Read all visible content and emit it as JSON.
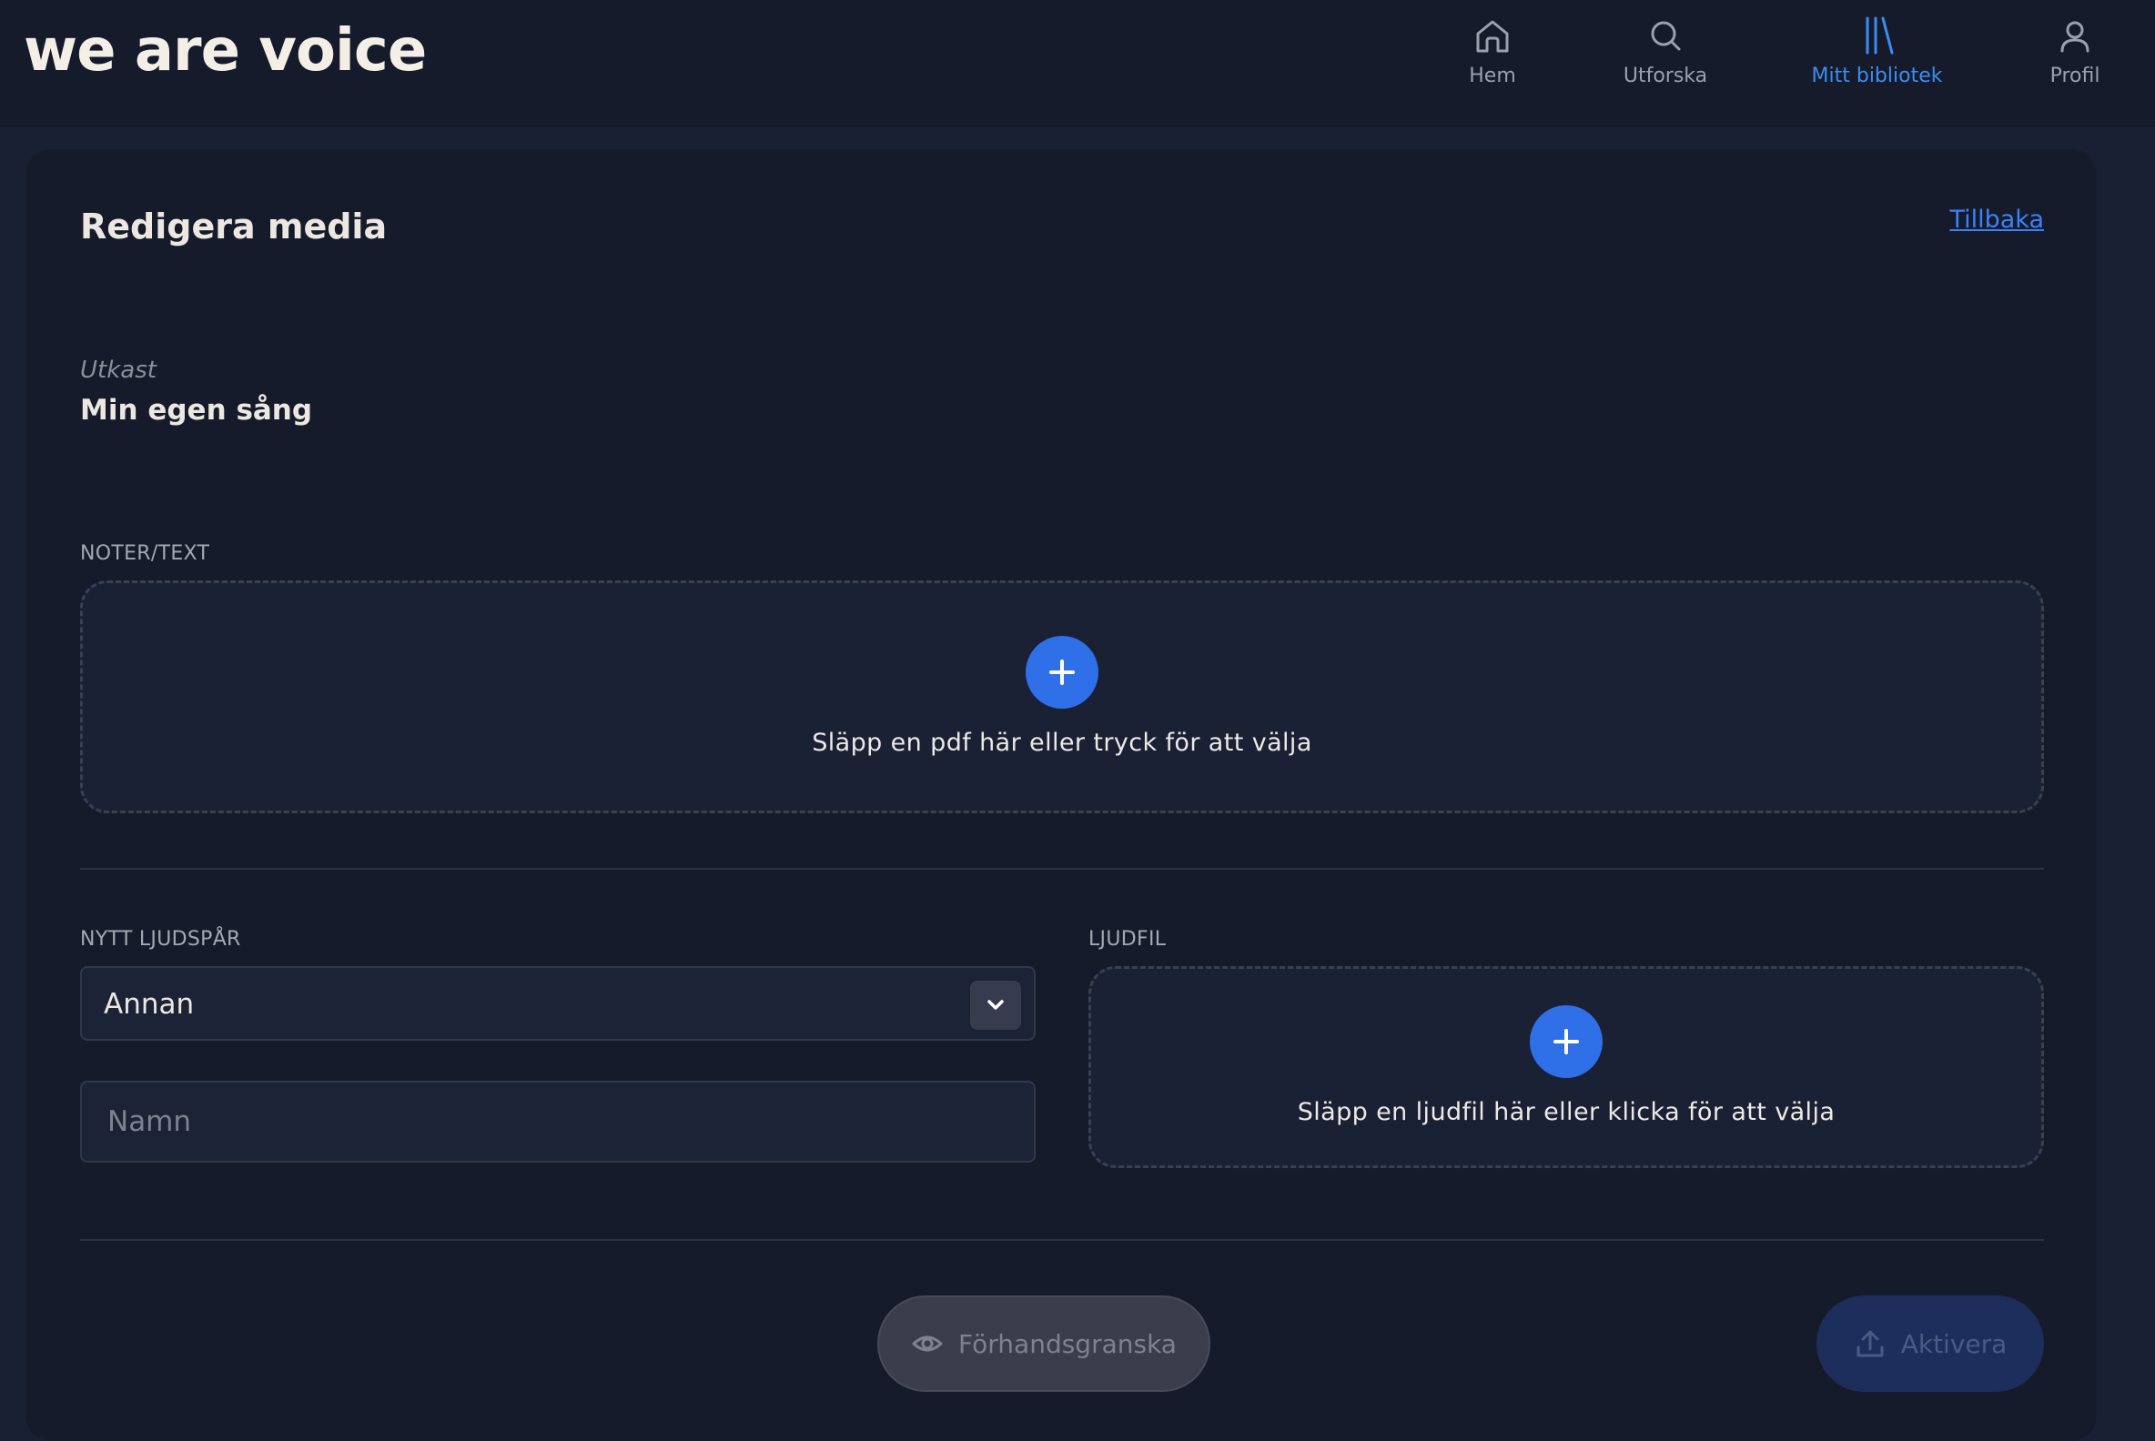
{
  "header": {
    "logo_text": "we are voice",
    "nav": [
      {
        "label": "Hem",
        "icon": "home-icon",
        "active": false
      },
      {
        "label": "Utforska",
        "icon": "search-icon",
        "active": false
      },
      {
        "label": "Mitt bibliotek",
        "icon": "library-icon",
        "active": true
      },
      {
        "label": "Profil",
        "icon": "user-icon",
        "active": false
      }
    ]
  },
  "colors": {
    "background": "#161b2c",
    "accent_blue": "#2f6fe8",
    "active_nav": "#3c8df0",
    "link": "#3b82f6"
  },
  "page": {
    "title": "Redigera media",
    "back_link": "Tillbaka",
    "status": "Utkast",
    "media_name": "Min egen sång"
  },
  "notes_section": {
    "label": "NOTER/TEXT",
    "dropzone_text": "Släpp en pdf här eller tryck för att välja"
  },
  "track_section": {
    "label": "NYTT LJUDSPÅR",
    "selected_value": "Annan",
    "name_placeholder": "Namn",
    "name_value": ""
  },
  "audio_section": {
    "label": "LJUDFIL",
    "dropzone_text": "Släpp en ljudfil här eller klicka för att välja"
  },
  "actions": {
    "preview_label": "Förhandsgranska",
    "activate_label": "Aktivera"
  }
}
